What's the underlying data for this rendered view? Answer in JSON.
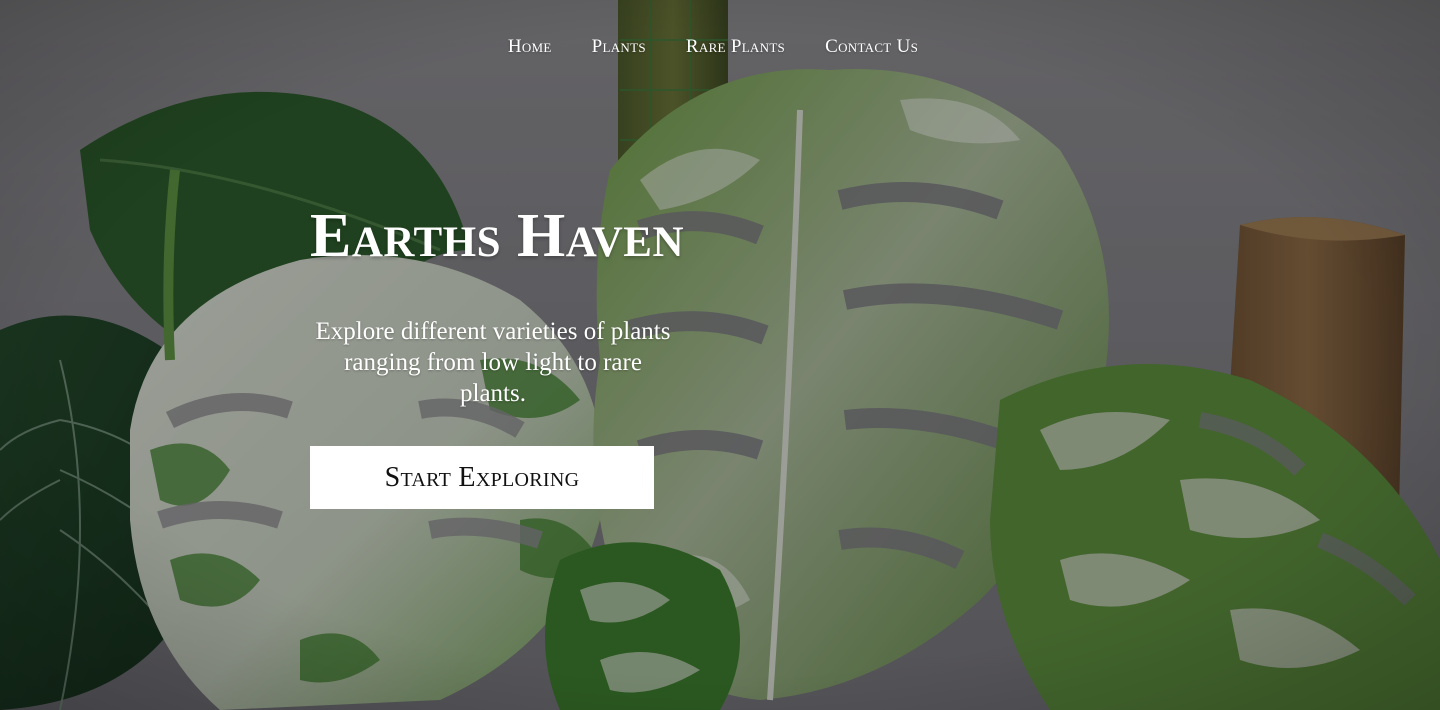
{
  "nav": {
    "items": [
      {
        "label": "Home"
      },
      {
        "label": "Plants"
      },
      {
        "label": "Rare Plants"
      },
      {
        "label": "Contact Us"
      }
    ]
  },
  "hero": {
    "title": "Earths Haven",
    "subtitle": "Explore different varieties of plants ranging from low light to rare plants.",
    "cta_label": "Start Exploring",
    "background_image": "variegated-monstera-plants-photo"
  },
  "colors": {
    "overlay": "#7d7c80",
    "text": "#ffffff",
    "button_bg": "#ffffff",
    "button_text": "#111111"
  }
}
